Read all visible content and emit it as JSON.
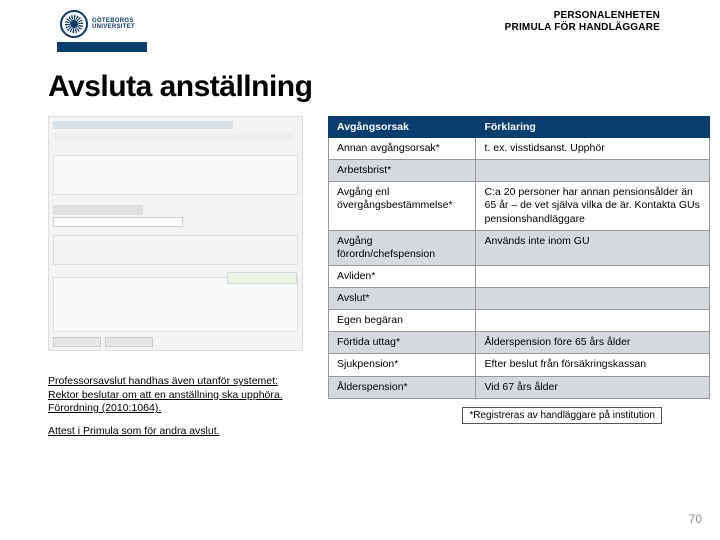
{
  "header": {
    "org_line1": "GÖTEBORGS",
    "org_line2": "UNIVERSITET",
    "right_line1": "PERSONALENHETEN",
    "right_line2": "PRIMULA FÖR HANDLÄGGARE"
  },
  "title": "Avsluta anställning",
  "table": {
    "head_col1": "Avgångsorsak",
    "head_col2": "Förklaring",
    "rows": [
      {
        "c1": "Annan avgångsorsak*",
        "c2": "t. ex. visstidsanst. Upphör",
        "alt": false
      },
      {
        "c1": "Arbetsbrist*",
        "c2": "",
        "alt": true
      },
      {
        "c1": "Avgång enl övergångsbestämmelse*",
        "c2": "C:a 20 personer har annan pensionsålder än 65 år – de vet själva vilka de är. Kontakta GUs pensionshandläggare",
        "alt": false
      },
      {
        "c1": "Avgång förordn/chefspension",
        "c2": "Används inte inom GU",
        "alt": true
      },
      {
        "c1": "Avliden*",
        "c2": "",
        "alt": false
      },
      {
        "c1": "Avslut*",
        "c2": "",
        "alt": true
      },
      {
        "c1": "Egen begäran",
        "c2": "",
        "alt": false
      },
      {
        "c1": "Förtida uttag*",
        "c2": "Ålderspension före 65 års ålder",
        "alt": true
      },
      {
        "c1": "Sjukpension*",
        "c2": "Efter beslut från försäkringskassan",
        "alt": false
      },
      {
        "c1": "Ålderspension*",
        "c2": "Vid 67 års ålder",
        "alt": true
      }
    ]
  },
  "notes": {
    "p1a": "Professorsavslut handhas även utanför systemet:",
    "p1b": "Rektor beslutar om att en anställning ska upphöra.",
    "p1c": "Förordning (2010:1064).",
    "p2": "Attest i Primula som för andra avslut."
  },
  "footnote": "*Registreras av handläggare på institution",
  "page_number": "70"
}
